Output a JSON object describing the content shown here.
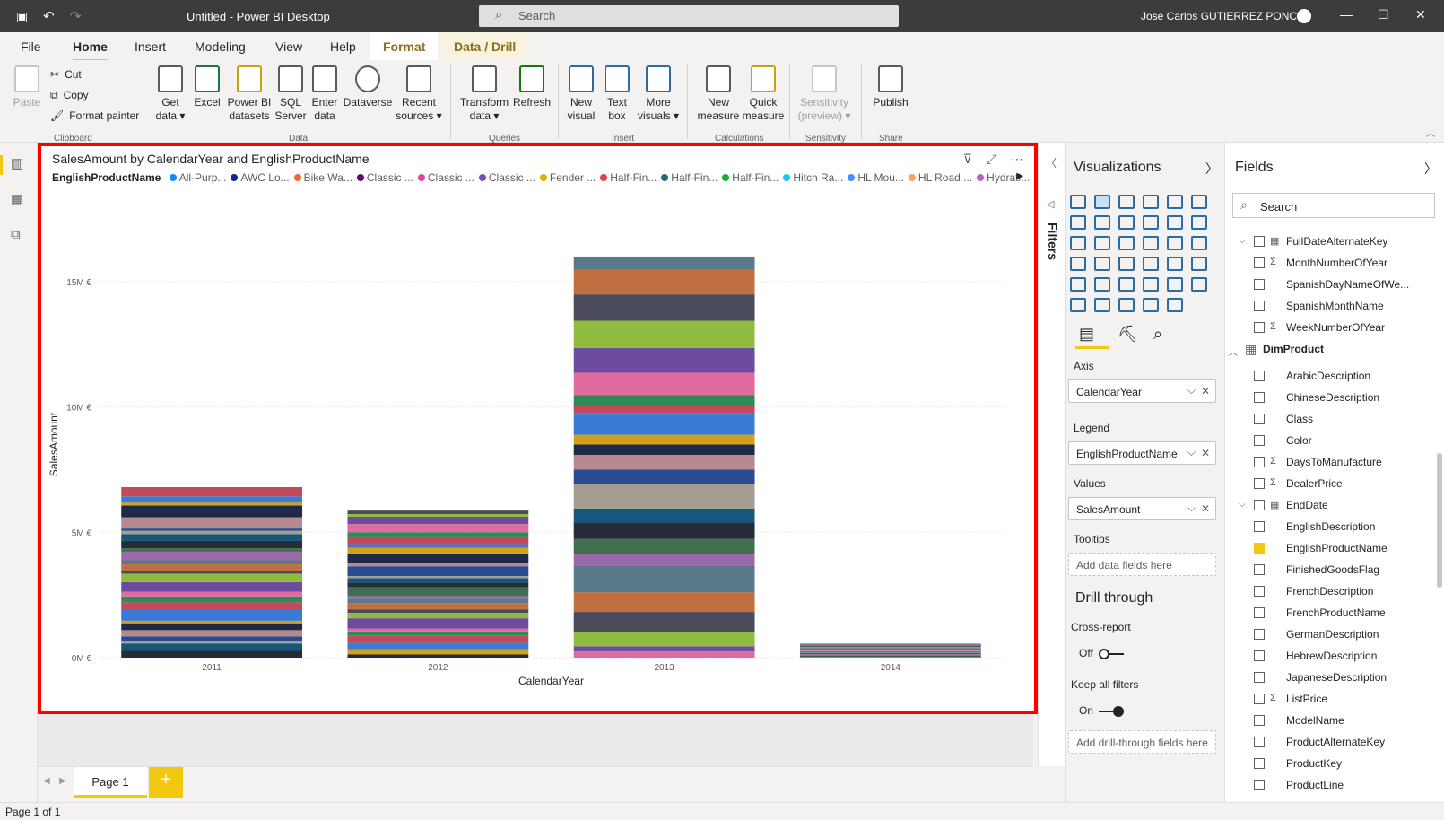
{
  "window": {
    "title": "Untitled - Power BI Desktop",
    "search_placeholder": "Search",
    "user": "Jose Carlos GUTIERREZ PONCE"
  },
  "tabs": [
    {
      "label": "File"
    },
    {
      "label": "Home"
    },
    {
      "label": "Insert"
    },
    {
      "label": "Modeling"
    },
    {
      "label": "View"
    },
    {
      "label": "Help"
    },
    {
      "label": "Format"
    },
    {
      "label": "Data / Drill"
    }
  ],
  "ribbon": {
    "paste": "Paste",
    "cut": "Cut",
    "copy": "Copy",
    "format_painter": "Format painter",
    "clipboard": "Clipboard",
    "get_data": "Get",
    "get_data2": "data",
    "excel": "Excel",
    "pbi": "Power BI",
    "pbi2": "datasets",
    "sql": "SQL",
    "sql2": "Server",
    "enter": "Enter",
    "enter2": "data",
    "dataverse": "Dataverse",
    "recent": "Recent",
    "recent2": "sources",
    "data": "Data",
    "transform": "Transform",
    "transform2": "data",
    "refresh": "Refresh",
    "queries": "Queries",
    "newvisual": "New",
    "newvisual2": "visual",
    "textbox": "Text",
    "textbox2": "box",
    "morevis": "More",
    "morevis2": "visuals",
    "insert": "Insert",
    "newmeasure": "New",
    "newmeasure2": "measure",
    "quickmeasure": "Quick",
    "quickmeasure2": "measure",
    "calculations": "Calculations",
    "sensitivity": "Sensitivity",
    "sensitivity2": "(preview)",
    "sensitivity_grp": "Sensitivity",
    "publish": "Publish",
    "share": "Share"
  },
  "visual": {
    "title": "SalesAmount by CalendarYear and EnglishProductName",
    "legend_title": "EnglishProductName",
    "legend": [
      {
        "label": "All-Purp...",
        "color": "#118dff"
      },
      {
        "label": "AWC Lo...",
        "color": "#12239e"
      },
      {
        "label": "Bike Wa...",
        "color": "#e66c37"
      },
      {
        "label": "Classic ...",
        "color": "#6b007b"
      },
      {
        "label": "Classic ...",
        "color": "#e044a7"
      },
      {
        "label": "Classic ...",
        "color": "#744ec2"
      },
      {
        "label": "Fender ...",
        "color": "#d9b300"
      },
      {
        "label": "Half-Fin...",
        "color": "#d64550"
      },
      {
        "label": "Half-Fin...",
        "color": "#197278"
      },
      {
        "label": "Half-Fin...",
        "color": "#1aab40"
      },
      {
        "label": "Hitch Ra...",
        "color": "#15c6f4"
      },
      {
        "label": "HL Mou...",
        "color": "#4092ff"
      },
      {
        "label": "HL Road ...",
        "color": "#ffa058"
      },
      {
        "label": "Hydrati...",
        "color": "#be5dc9"
      }
    ]
  },
  "chart_data": {
    "type": "bar",
    "stacked": true,
    "title": "SalesAmount by CalendarYear and EnglishProductName",
    "xlabel": "CalendarYear",
    "ylabel": "SalesAmount",
    "categories": [
      "2011",
      "2012",
      "2013",
      "2014"
    ],
    "totals": [
      6.8,
      5.9,
      16.0,
      0.55
    ],
    "ylim": [
      0,
      17
    ],
    "yticks": [
      "0M €",
      "5M €",
      "10M €",
      "15M €"
    ],
    "ytick_values": [
      0,
      5,
      10,
      15
    ],
    "grid": true,
    "legend_position": "top"
  },
  "pages": {
    "page1": "Page 1",
    "add": "+"
  },
  "status": "Page 1 of 1",
  "filters": {
    "label": "Filters"
  },
  "viz": {
    "title": "Visualizations",
    "axis": "Axis",
    "axis_value": "CalendarYear",
    "legend": "Legend",
    "legend_value": "EnglishProductName",
    "values": "Values",
    "values_value": "SalesAmount",
    "tooltips": "Tooltips",
    "tooltips_placeholder": "Add data fields here",
    "drill": "Drill through",
    "cross": "Cross-report",
    "off": "Off",
    "keep": "Keep all filters",
    "on": "On",
    "drill_placeholder": "Add drill-through fields here"
  },
  "fields": {
    "title": "Fields",
    "search": "Search",
    "items": [
      {
        "label": "FullDateAlternateKey",
        "type": "table-sub"
      },
      {
        "label": "MonthNumberOfYear",
        "type": "sigma"
      },
      {
        "label": "SpanishDayNameOfWe...",
        "type": "field"
      },
      {
        "label": "SpanishMonthName",
        "type": "field"
      },
      {
        "label": "WeekNumberOfYear",
        "type": "sigma"
      },
      {
        "label": "DimProduct",
        "type": "table"
      },
      {
        "label": "ArabicDescription",
        "type": "field"
      },
      {
        "label": "ChineseDescription",
        "type": "field"
      },
      {
        "label": "Class",
        "type": "field"
      },
      {
        "label": "Color",
        "type": "field"
      },
      {
        "label": "DaysToManufacture",
        "type": "sigma"
      },
      {
        "label": "DealerPrice",
        "type": "sigma"
      },
      {
        "label": "EndDate",
        "type": "table-sub"
      },
      {
        "label": "EnglishDescription",
        "type": "field"
      },
      {
        "label": "EnglishProductName",
        "type": "checked"
      },
      {
        "label": "FinishedGoodsFlag",
        "type": "field"
      },
      {
        "label": "FrenchDescription",
        "type": "field"
      },
      {
        "label": "FrenchProductName",
        "type": "field"
      },
      {
        "label": "GermanDescription",
        "type": "field"
      },
      {
        "label": "HebrewDescription",
        "type": "field"
      },
      {
        "label": "JapaneseDescription",
        "type": "field"
      },
      {
        "label": "ListPrice",
        "type": "sigma"
      },
      {
        "label": "ModelName",
        "type": "field"
      },
      {
        "label": "ProductAlternateKey",
        "type": "field"
      },
      {
        "label": "ProductKey",
        "type": "field"
      },
      {
        "label": "ProductLine",
        "type": "field"
      }
    ]
  }
}
